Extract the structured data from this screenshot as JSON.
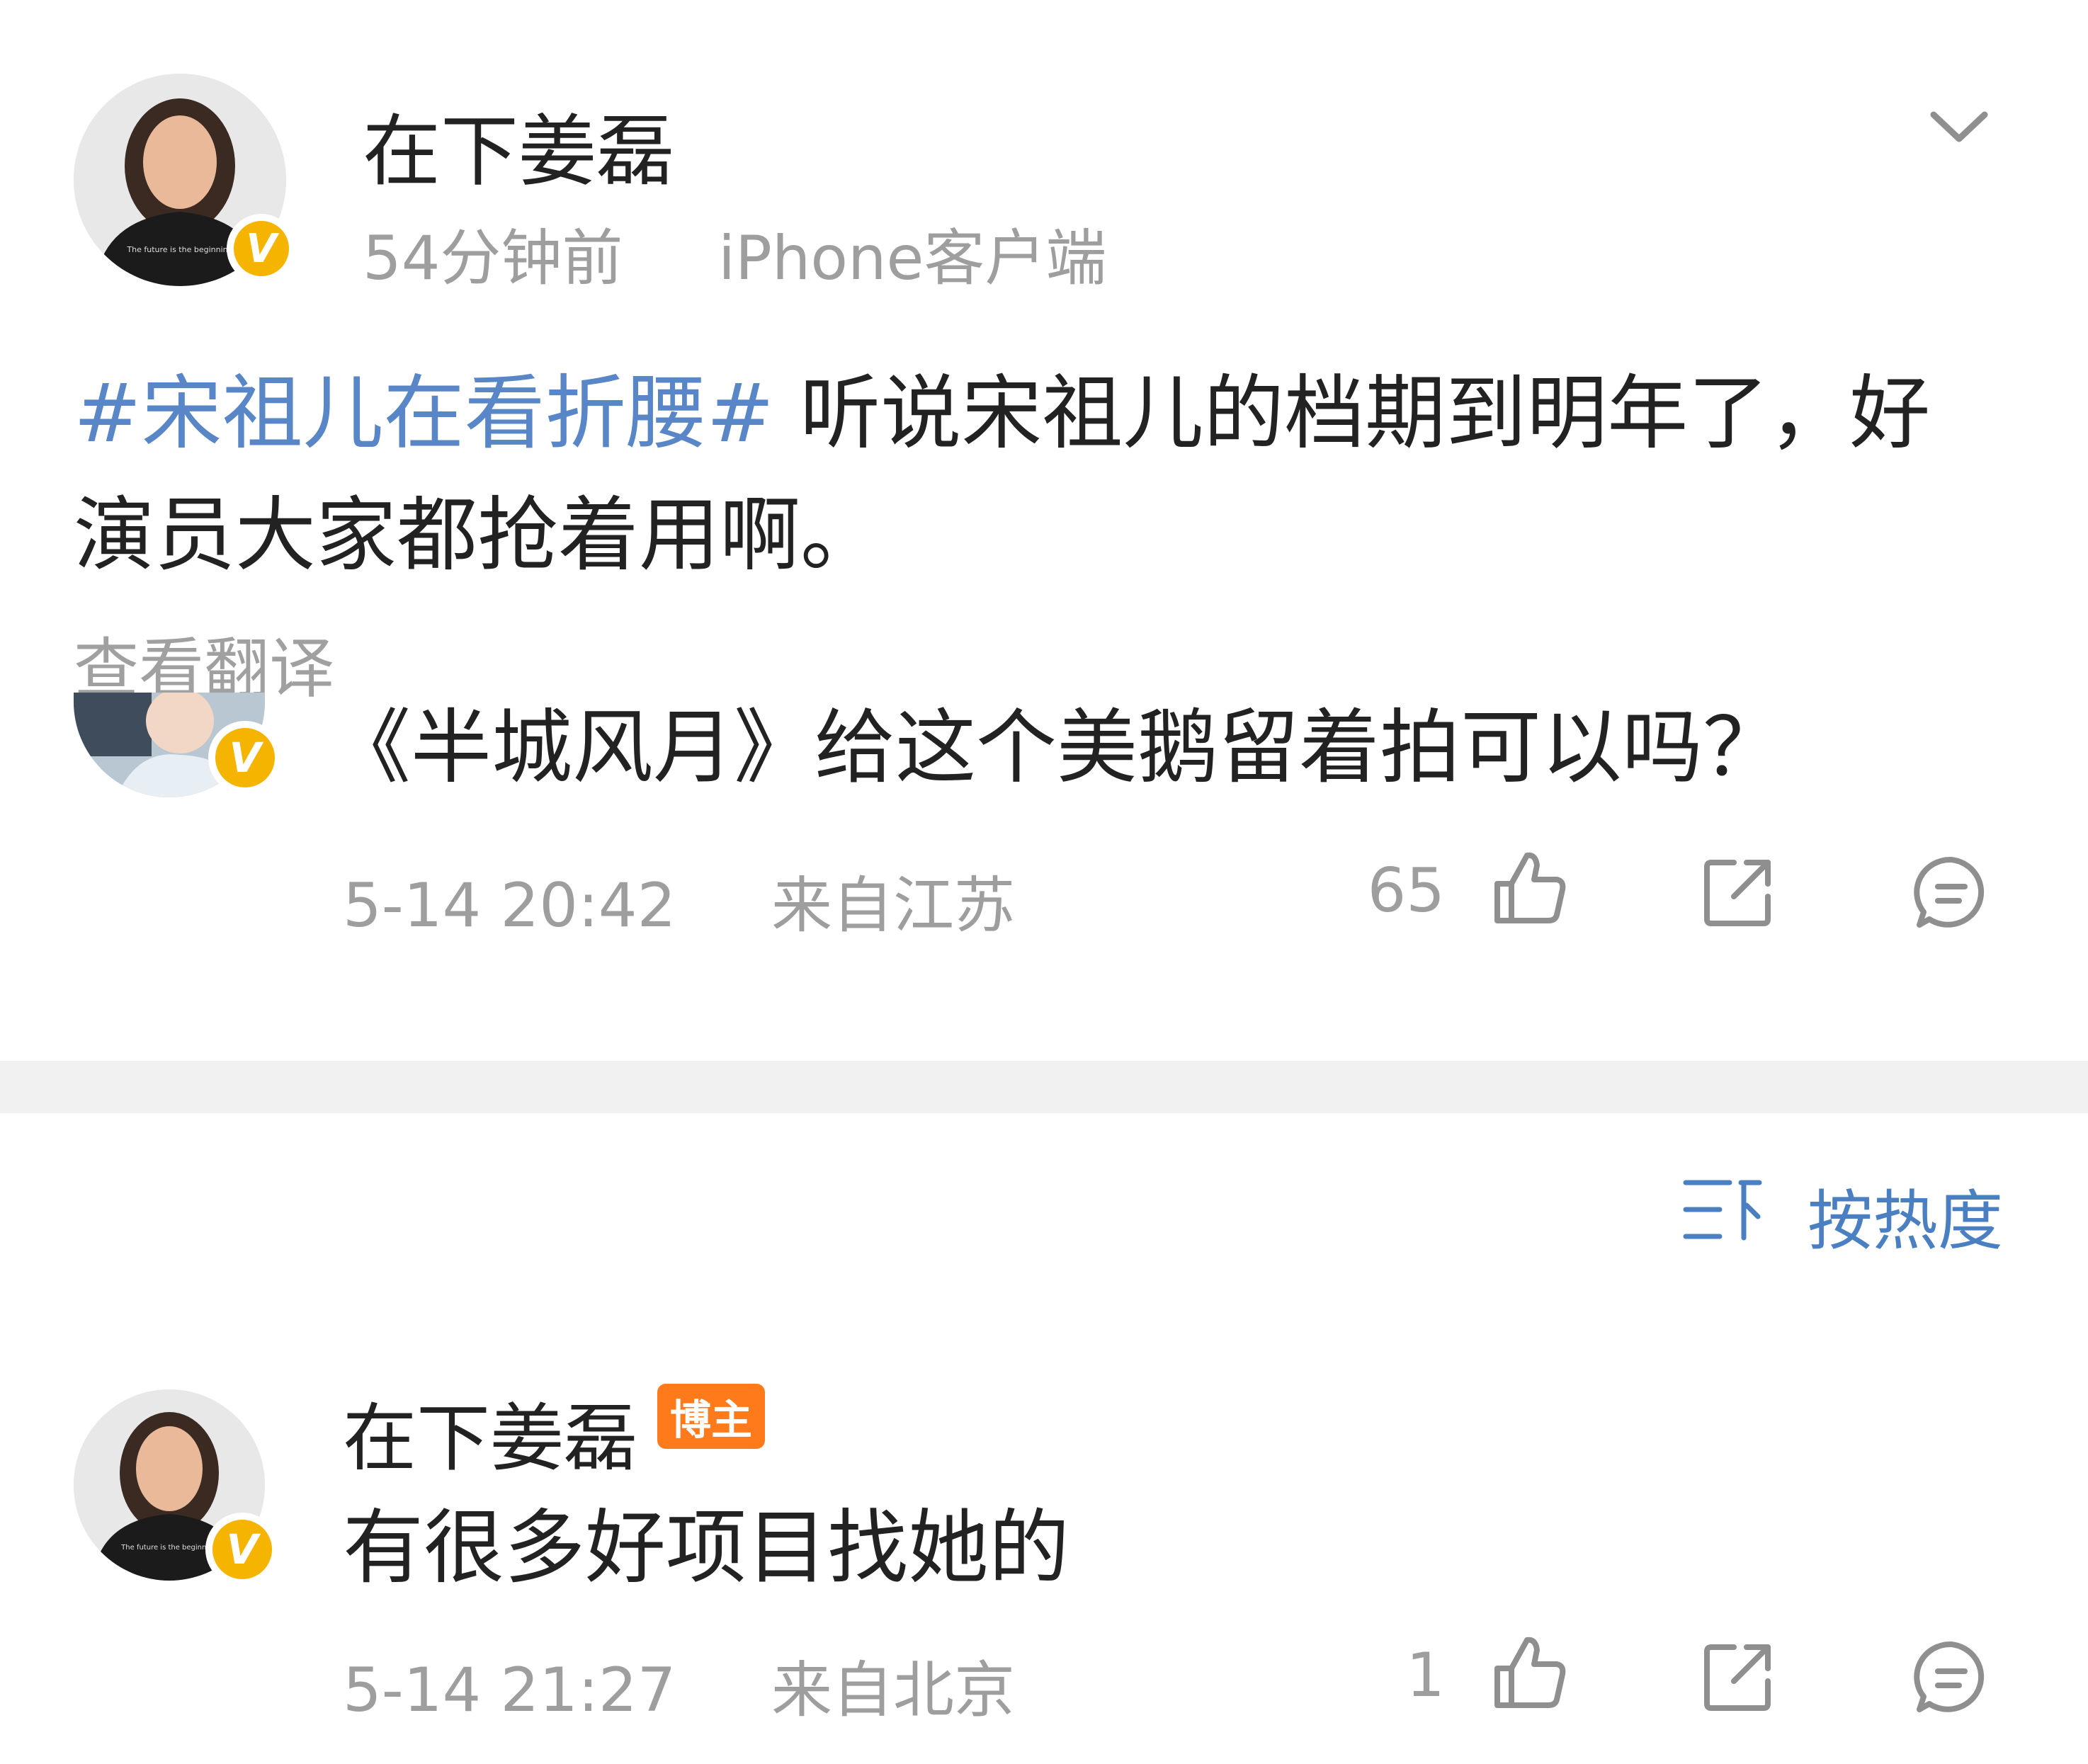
{
  "post": {
    "author": "在下姜磊",
    "time": "54分钟前",
    "source": "iPhone客户端",
    "topic": "#宋祖儿在看折腰#",
    "text_line1": " 听说宋祖儿的档期到明年了，好",
    "text_line2": "演员大家都抢着用啊。",
    "translate": "查看翻译"
  },
  "comment1": {
    "text": "《半城风月》给这个美鹅留着拍可以吗？",
    "date": "5-14 20:42",
    "location": "来自江苏",
    "likes": "65"
  },
  "sort": {
    "label": "按热度"
  },
  "comment2": {
    "author": "在下姜磊",
    "badge": "博主",
    "text": "有很多好项目找她的",
    "date": "5-14 21:27",
    "location": "来自北京",
    "likes": "1"
  },
  "avatar_shirt_text": "The future is the beginning",
  "colors": {
    "link": "#5886c7",
    "verified": "#f5b400",
    "host_badge": "#ff7a1a",
    "meta": "#9e9e9e"
  },
  "icons": [
    "chevron-down-icon",
    "like-icon",
    "share-icon",
    "comment-icon",
    "sort-icon",
    "verified-icon"
  ]
}
